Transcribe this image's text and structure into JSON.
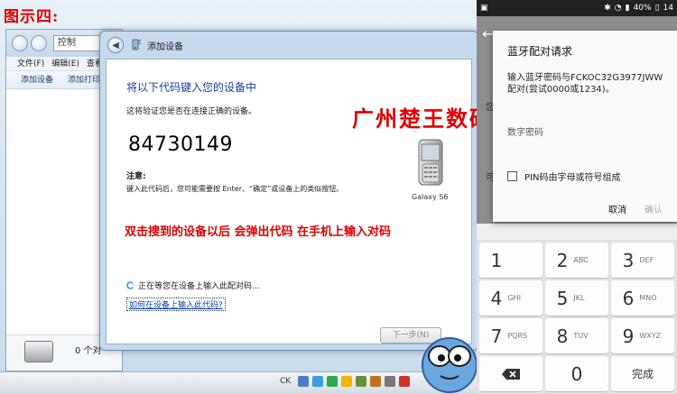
{
  "caption": {
    "top": "图示四:",
    "middle": "双击搜到的设备以后 会弹出代码 在手机上输入对码",
    "brand": "广州楚王数码"
  },
  "explorer": {
    "address": "控制",
    "menu": [
      "文件(F)",
      "编辑(E)",
      "查看"
    ],
    "toolbar": [
      "添加设备",
      "添加打印"
    ],
    "status": "0 个对"
  },
  "dialog": {
    "title": "添加设备",
    "heading": "将以下代码键入您的设备中",
    "verify": "这将验证您是否在连接正确的设备。",
    "code": "84730149",
    "note_label": "注意:",
    "note_text": "键入此代码后，您可能需要按 Enter、“确定”或设备上的类似按钮。",
    "device_name": "Galaxy S6",
    "waiting": "正在等您在设备上输入此配对码...",
    "help_link": "如何在设备上输入此代码?",
    "next_button": "下一步(N)"
  },
  "taskbar": {
    "ime": "CK"
  },
  "phone": {
    "status": {
      "battery": "40%",
      "time": "14"
    },
    "behind_texts": [
      "您",
      "可"
    ],
    "dialog": {
      "title": "蓝牙配对请求",
      "message": "输入蓝牙密码与FCKOC32G3977JWW配对(尝试0000或1234)。",
      "input_label": "数字密码",
      "checkbox_label": "PIN码由字母或符号组成",
      "cancel": "取消",
      "ok": "确认"
    },
    "keypad": [
      {
        "num": "1",
        "letters": ""
      },
      {
        "num": "2",
        "letters": "ABC"
      },
      {
        "num": "3",
        "letters": "DEF"
      },
      {
        "num": "4",
        "letters": "GHI"
      },
      {
        "num": "5",
        "letters": "JKL"
      },
      {
        "num": "6",
        "letters": "MNO"
      },
      {
        "num": "7",
        "letters": "PQRS"
      },
      {
        "num": "8",
        "letters": "TUV"
      },
      {
        "num": "9",
        "letters": "WXYZ"
      }
    ],
    "zero": "0",
    "done": "完成"
  },
  "colors": {
    "caption_red": "#e00000",
    "heading_blue": "#1e3ea0",
    "dialog_frame": "#c6daee"
  }
}
